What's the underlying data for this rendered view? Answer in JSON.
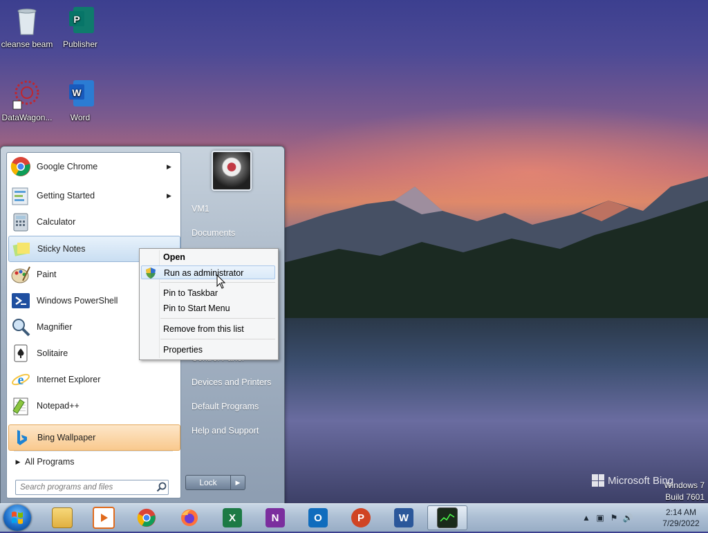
{
  "desktop": {
    "icons": [
      {
        "label": "cleanse beam",
        "icon": "recycle-bin-icon"
      },
      {
        "label": "Publisher",
        "icon": "publisher-icon"
      },
      {
        "label": "DataWagon...",
        "icon": "datawagon-icon"
      },
      {
        "label": "Word",
        "icon": "word-icon"
      }
    ]
  },
  "start_menu": {
    "programs": [
      {
        "label": "Google Chrome",
        "icon": "chrome-icon",
        "has_submenu": true
      },
      {
        "label": "Getting Started",
        "icon": "getting-started-icon",
        "has_submenu": true
      },
      {
        "label": "Calculator",
        "icon": "calculator-icon",
        "has_submenu": false
      },
      {
        "label": "Sticky Notes",
        "icon": "sticky-notes-icon",
        "has_submenu": false
      },
      {
        "label": "Paint",
        "icon": "paint-icon",
        "has_submenu": false
      },
      {
        "label": "Windows PowerShell",
        "icon": "powershell-icon",
        "has_submenu": false
      },
      {
        "label": "Magnifier",
        "icon": "magnifier-icon",
        "has_submenu": false
      },
      {
        "label": "Solitaire",
        "icon": "solitaire-icon",
        "has_submenu": false
      },
      {
        "label": "Internet Explorer",
        "icon": "internet-explorer-icon",
        "has_submenu": false
      },
      {
        "label": "Notepad++",
        "icon": "notepadpp-icon",
        "has_submenu": false
      },
      {
        "label": "Bing Wallpaper",
        "icon": "bing-icon",
        "has_submenu": false
      }
    ],
    "all_programs": "All Programs",
    "search_placeholder": "Search programs and files",
    "right_items": {
      "user": "VM1",
      "documents": "Documents",
      "control_panel": "Control Panel",
      "devices": "Devices and Printers",
      "default_programs": "Default Programs",
      "help": "Help and Support"
    },
    "lock_label": "Lock"
  },
  "context_menu": {
    "open": "Open",
    "run_admin": "Run as administrator",
    "pin_taskbar": "Pin to Taskbar",
    "pin_start": "Pin to Start Menu",
    "remove": "Remove from this list",
    "properties": "Properties"
  },
  "taskbar": {
    "apps": [
      {
        "name": "explorer",
        "icon": "folder-icon"
      },
      {
        "name": "media",
        "icon": "media-player-icon"
      },
      {
        "name": "chrome",
        "icon": "chrome-icon"
      },
      {
        "name": "firefox",
        "icon": "firefox-icon"
      },
      {
        "name": "excel",
        "icon": "excel-icon",
        "letter": "X"
      },
      {
        "name": "onenote",
        "icon": "onenote-icon",
        "letter": "N"
      },
      {
        "name": "outlook",
        "icon": "outlook-icon",
        "letter": "O"
      },
      {
        "name": "powerpoint",
        "icon": "powerpoint-icon",
        "letter": "P"
      },
      {
        "name": "word",
        "icon": "word-icon",
        "letter": "W"
      },
      {
        "name": "task-manager",
        "icon": "task-manager-icon"
      }
    ],
    "clock_time": "2:14 AM",
    "clock_date": "7/29/2022"
  },
  "watermark": {
    "bing": "Microsoft Bing",
    "os_line1": "Windows 7",
    "os_line2": "Build 7601"
  },
  "colors": {
    "excel": "#1d7a45",
    "onenote": "#7b2e9e",
    "outlook": "#0f6cbd",
    "powerpoint": "#d04423",
    "word": "#2b579a"
  }
}
